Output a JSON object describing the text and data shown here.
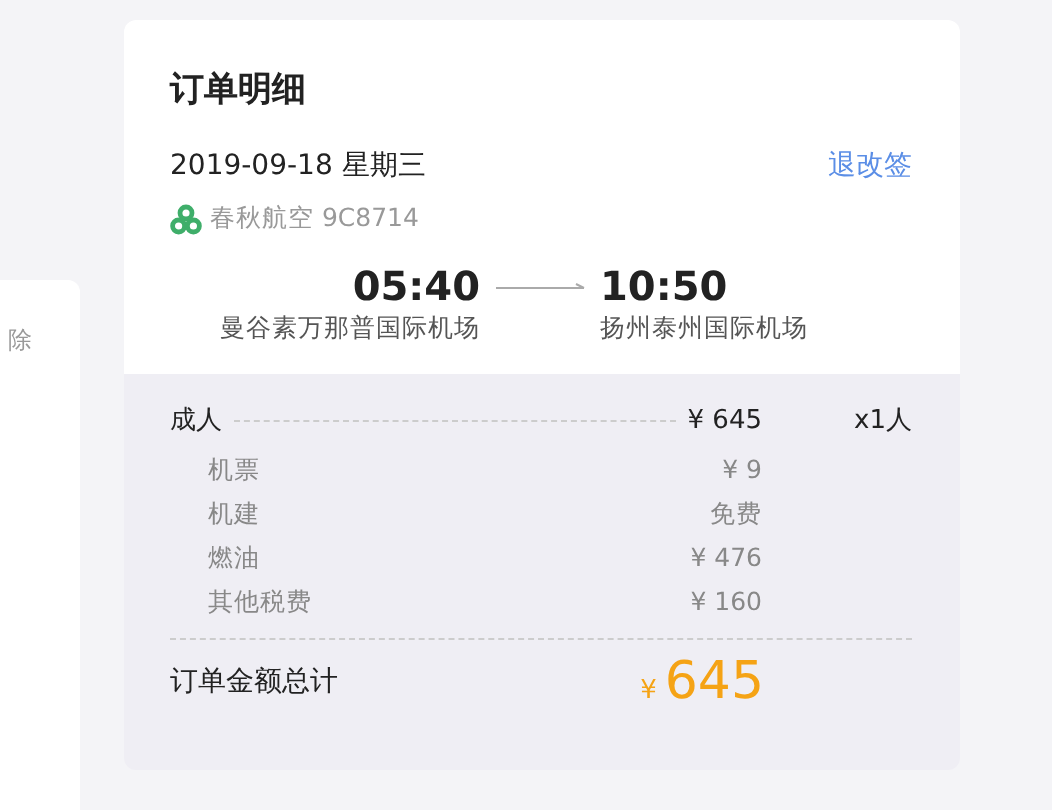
{
  "side_panel": {
    "text": "除"
  },
  "order": {
    "title": "订单明细",
    "date": "2019-09-18 星期三",
    "change_link": "退改签",
    "airline": "春秋航空 9C8714",
    "departure": {
      "time": "05:40",
      "airport": "曼谷素万那普国际机场"
    },
    "arrival": {
      "time": "10:50",
      "airport": "扬州泰州国际机场"
    }
  },
  "fare": {
    "passenger": {
      "label": "成人",
      "price": "¥ 645",
      "count": "x1人"
    },
    "items": [
      {
        "label": "机票",
        "value": "¥ 9"
      },
      {
        "label": "机建",
        "value": "免费"
      },
      {
        "label": "燃油",
        "value": "¥ 476"
      },
      {
        "label": "其他税费",
        "value": "¥ 160"
      }
    ],
    "total": {
      "label": "订单金额总计",
      "currency": "¥",
      "amount": "645"
    }
  }
}
